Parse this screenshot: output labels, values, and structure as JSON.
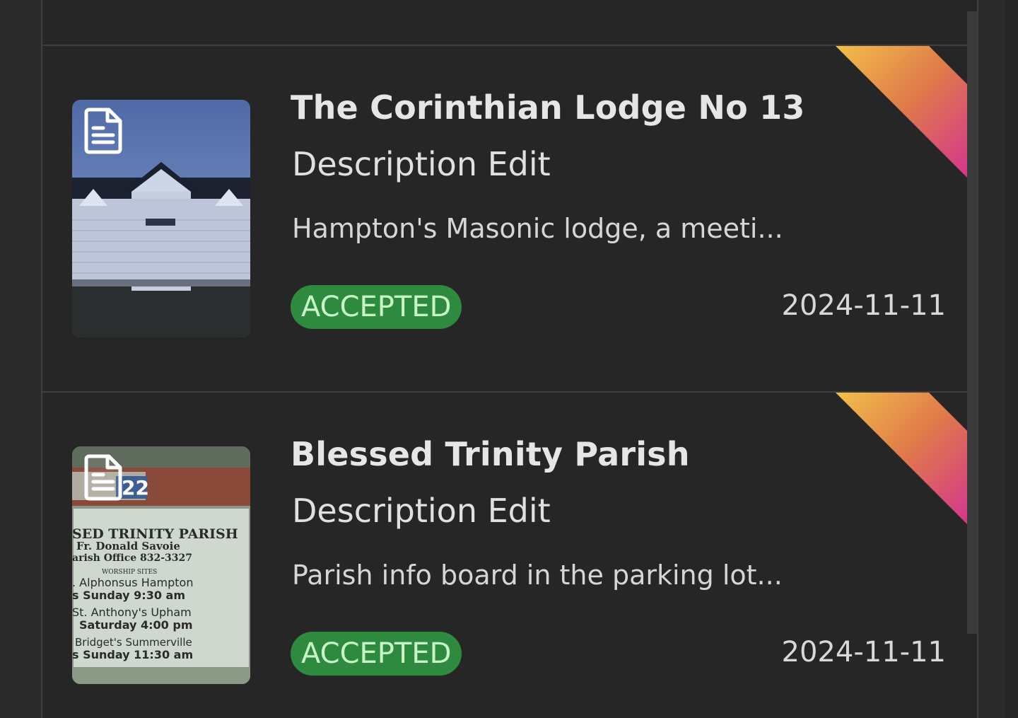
{
  "theme": {
    "accent_badge_bg": "#2e8a3e",
    "accent_badge_text": "#c8f5c8",
    "ribbon_gradient": [
      "#f2c04a",
      "#e07a4a",
      "#d22a9a"
    ]
  },
  "items": [
    {
      "title": "The Corinthian Lodge No 13",
      "type": "Description Edit",
      "description": "Hampton's Masonic lodge, a meeti...",
      "status": "ACCEPTED",
      "date": "2024-11-11",
      "icon": "document-icon",
      "thumbnail": "photo of white lodge building at dusk"
    },
    {
      "title": "Blessed Trinity Parish",
      "type": "Description Edit",
      "description": "Parish info board in the parking lot...",
      "status": "ACCEPTED",
      "date": "2024-11-11",
      "icon": "document-icon",
      "thumbnail": "photo of parish sign board",
      "sign": {
        "number": "22",
        "lines": [
          "SED TRINITY PARISH",
          "Fr. Donald Savoie",
          "arish Office 832-3327",
          "WORSHIP SITES",
          ". Alphonsus  Hampton",
          "s Sunday 9:30 am",
          "St. Anthony's Upham",
          "Saturday 4:00 pm",
          "Bridget's Summerville",
          "s Sunday  11:30 am"
        ]
      }
    }
  ]
}
